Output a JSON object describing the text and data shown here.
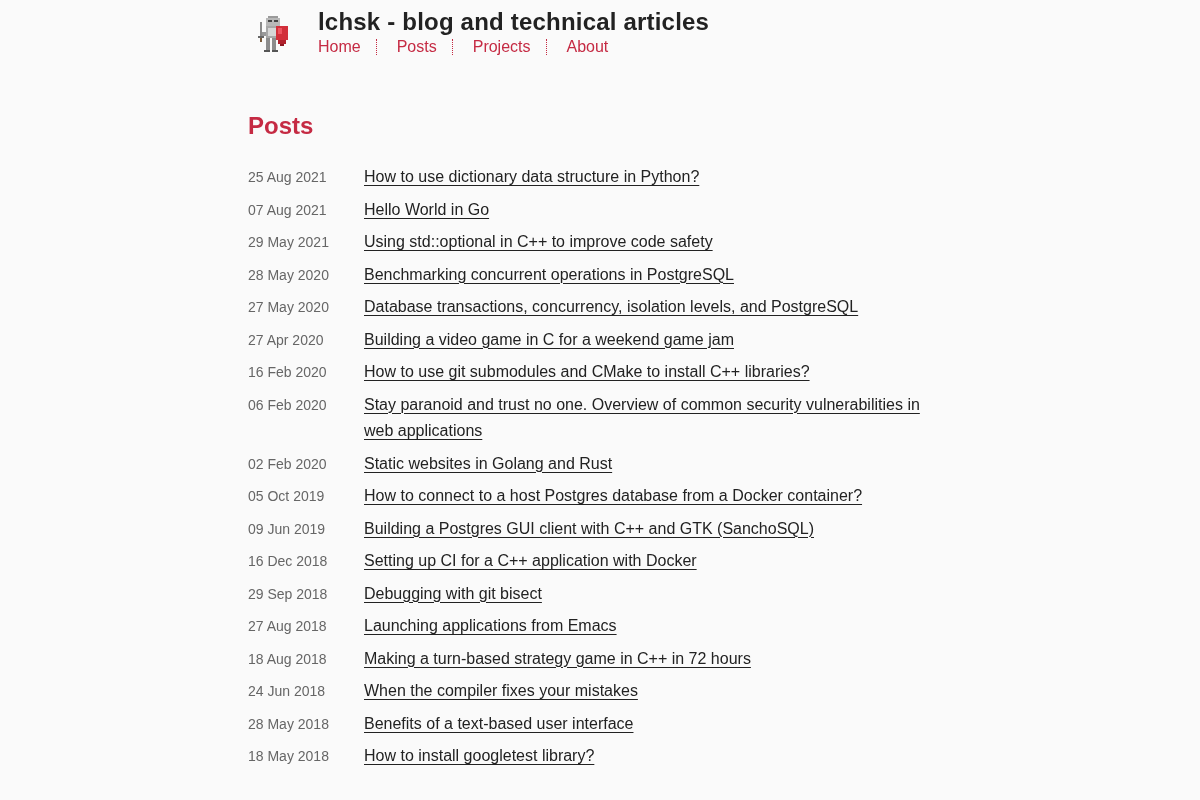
{
  "header": {
    "title": "lchsk - blog and technical articles",
    "nav": [
      {
        "label": "Home"
      },
      {
        "label": "Posts"
      },
      {
        "label": "Projects"
      },
      {
        "label": "About"
      }
    ]
  },
  "page_title": "Posts",
  "posts": [
    {
      "date": "25 Aug 2021",
      "title": "How to use dictionary data structure in Python?"
    },
    {
      "date": "07 Aug 2021",
      "title": "Hello World in Go"
    },
    {
      "date": "29 May 2021",
      "title": "Using std::optional in C++ to improve code safety"
    },
    {
      "date": "28 May 2020",
      "title": "Benchmarking concurrent operations in PostgreSQL"
    },
    {
      "date": "27 May 2020",
      "title": "Database transactions, concurrency, isolation levels, and PostgreSQL"
    },
    {
      "date": "27 Apr 2020",
      "title": "Building a video game in C for a weekend game jam"
    },
    {
      "date": "16 Feb 2020",
      "title": "How to use git submodules and CMake to install C++ libraries?"
    },
    {
      "date": "06 Feb 2020",
      "title": "Stay paranoid and trust no one. Overview of common security vulnerabilities in web applications"
    },
    {
      "date": "02 Feb 2020",
      "title": "Static websites in Golang and Rust"
    },
    {
      "date": "05 Oct 2019",
      "title": "How to connect to a host Postgres database from a Docker container?"
    },
    {
      "date": "09 Jun 2019",
      "title": "Building a Postgres GUI client with C++ and GTK (SanchoSQL)"
    },
    {
      "date": "16 Dec 2018",
      "title": "Setting up CI for a C++ application with Docker"
    },
    {
      "date": "29 Sep 2018",
      "title": "Debugging with git bisect"
    },
    {
      "date": "27 Aug 2018",
      "title": "Launching applications from Emacs"
    },
    {
      "date": "18 Aug 2018",
      "title": "Making a turn-based strategy game in C++ in 72 hours"
    },
    {
      "date": "24 Jun 2018",
      "title": "When the compiler fixes your mistakes"
    },
    {
      "date": "28 May 2018",
      "title": "Benefits of a text-based user interface"
    },
    {
      "date": "18 May 2018",
      "title": "How to install googletest library?"
    }
  ]
}
